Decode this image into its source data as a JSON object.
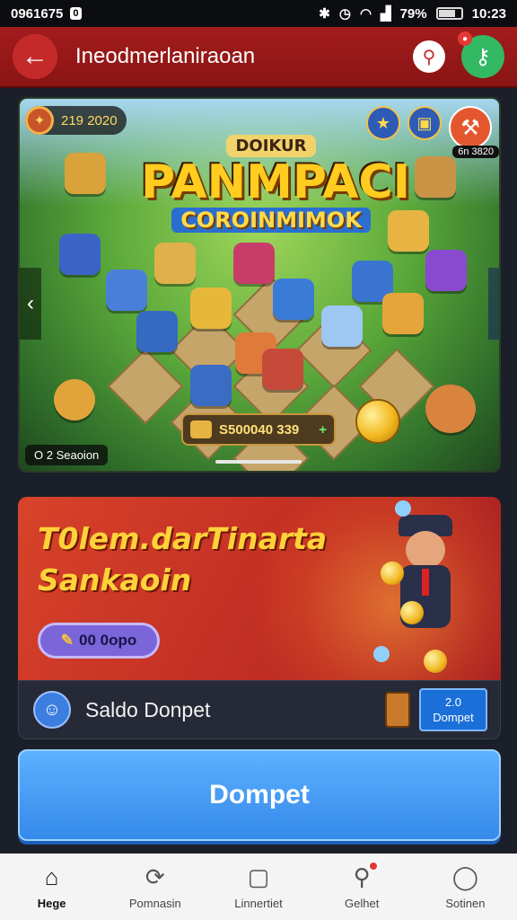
{
  "status_bar": {
    "left_text": "0961675",
    "left_badge": "0",
    "battery": "79%",
    "time": "10:23"
  },
  "header": {
    "title": "Ineodmerlaniraoan"
  },
  "game_banner": {
    "score": "219 2020",
    "title_top": "DOIKUR",
    "title_main": "PANMPACI",
    "title_tag": "COROINMIMOK",
    "top_badge": "6n 3820",
    "coin_amount": "S500040 339",
    "coin_plus": "+",
    "footer_label": "O 2 Seaoion"
  },
  "promo": {
    "title_line1": "T0lem.darTinarta",
    "title_line2": "Sankaoin",
    "button_label": "00 0opo"
  },
  "saldo": {
    "label": "Saldo Donpet",
    "wallet_amount": "2.0",
    "wallet_label": "Dompet"
  },
  "main_button": {
    "label": "Dompet"
  },
  "bottom_nav": {
    "items": [
      {
        "label": "Hege",
        "icon": "home-icon",
        "active": true
      },
      {
        "label": "Pomnasin",
        "icon": "refresh-gear-icon",
        "active": false
      },
      {
        "label": "Linnertiet",
        "icon": "square-icon",
        "active": false
      },
      {
        "label": "Gelhet",
        "icon": "search-icon",
        "active": false
      },
      {
        "label": "Sotinen",
        "icon": "profile-icon",
        "active": false
      }
    ]
  }
}
